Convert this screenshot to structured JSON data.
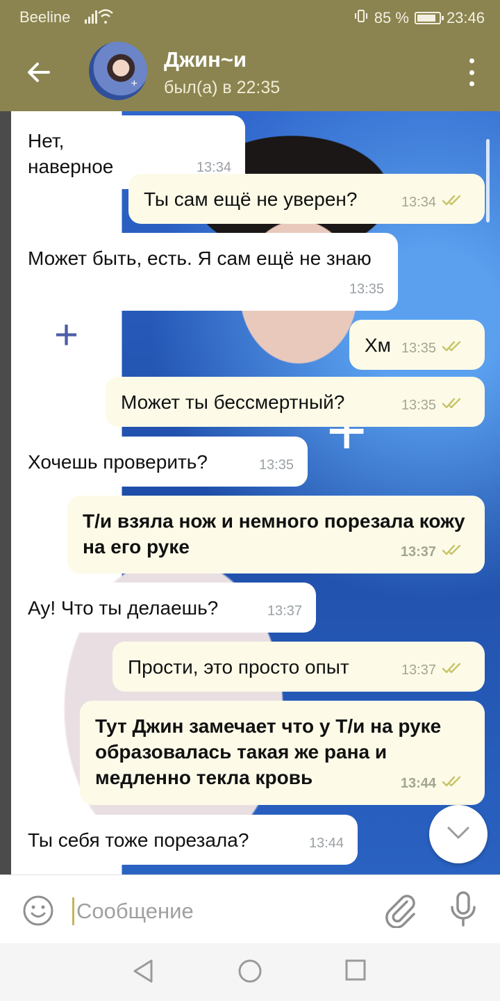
{
  "status_bar": {
    "carrier": "Beeline",
    "battery_text": "85 %",
    "battery_level": 0.85,
    "time": "23:46",
    "icons": [
      "signal-icon",
      "wifi-icon",
      "vibrate-icon",
      "battery-icon"
    ]
  },
  "header": {
    "contact_name": "Джин~и",
    "last_seen": "был(а) в 22:35",
    "icons": [
      "back-arrow-icon",
      "avatar",
      "more-vert-icon"
    ]
  },
  "messages": [
    {
      "dir": "in",
      "text": "Нет, наверное",
      "time": "13:34",
      "bold": false
    },
    {
      "dir": "out",
      "text": "Ты сам ещё не уверен?",
      "time": "13:34",
      "bold": false,
      "read": true
    },
    {
      "dir": "in",
      "text": "Может быть, есть. Я сам ещё не знаю",
      "time": "13:35",
      "bold": false
    },
    {
      "dir": "out",
      "text": "Хм",
      "time": "13:35",
      "bold": false,
      "read": true
    },
    {
      "dir": "out",
      "text": "Может ты бессмертный?",
      "time": "13:35",
      "bold": false,
      "read": true
    },
    {
      "dir": "in",
      "text": "Хочешь проверить?",
      "time": "13:35",
      "bold": false
    },
    {
      "dir": "out",
      "text": "Т/и взяла нож и немного порезала кожу на его руке",
      "time": "13:37",
      "bold": true,
      "read": true
    },
    {
      "dir": "in",
      "text": "Ау! Что ты делаешь?",
      "time": "13:37",
      "bold": false
    },
    {
      "dir": "out",
      "text": "Прости, это просто опыт",
      "time": "13:37",
      "bold": false,
      "read": true
    },
    {
      "dir": "out",
      "text": "Тут Джин замечает что у Т/и на руке образовалась такая же рана и медленно текла кровь",
      "time": "13:44",
      "bold": true,
      "read": true
    },
    {
      "dir": "in",
      "text": "Ты себя тоже порезала?",
      "time": "13:44",
      "bold": false
    }
  ],
  "composer": {
    "placeholder": "Сообщение",
    "value": "",
    "icons": [
      "emoji-icon",
      "attach-icon",
      "mic-icon"
    ]
  },
  "fab": {
    "icon": "chevron-down-icon"
  },
  "nav": {
    "icons": [
      "back-triangle-icon",
      "home-circle-icon",
      "recents-square-icon"
    ]
  },
  "colors": {
    "header": "#8b8450",
    "bubble_in": "#ffffff",
    "bubble_out": "#fdfbe8",
    "tick": "#c8c46a"
  }
}
